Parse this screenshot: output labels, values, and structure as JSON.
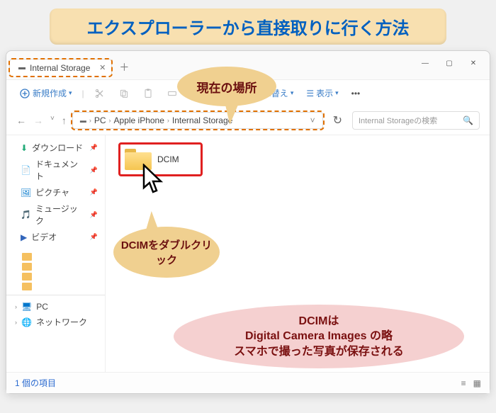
{
  "banner": "エクスプローラーから直接取りに行く方法",
  "tab": {
    "title": "Internal Storage"
  },
  "toolbar": {
    "new": "新規作成",
    "sort": "並べ替え",
    "view": "表示"
  },
  "breadcrumb": {
    "segments": [
      "PC",
      "Apple iPhone",
      "Internal Storage"
    ]
  },
  "search": {
    "placeholder": "Internal Storageの検索"
  },
  "sidebar": {
    "items": [
      {
        "label": "ダウンロード",
        "icon": "↓",
        "pin": true
      },
      {
        "label": "ドキュメント",
        "icon": "📄",
        "pin": true
      },
      {
        "label": "ピクチャ",
        "icon": "🖼",
        "pin": true
      },
      {
        "label": "ミュージック",
        "icon": "🎵",
        "pin": true
      },
      {
        "label": "ビデオ",
        "icon": "▶",
        "pin": true
      }
    ],
    "pc": "PC",
    "network": "ネットワーク"
  },
  "content": {
    "folder_label": "DCIM"
  },
  "callouts": {
    "c1": "現在の場所",
    "c2": "DCIMをダブルクリック",
    "pink": "DCIMは\nDigital Camera Images の略\nスマホで撮った写真が保存される"
  },
  "status": {
    "count": "1 個の項目"
  }
}
